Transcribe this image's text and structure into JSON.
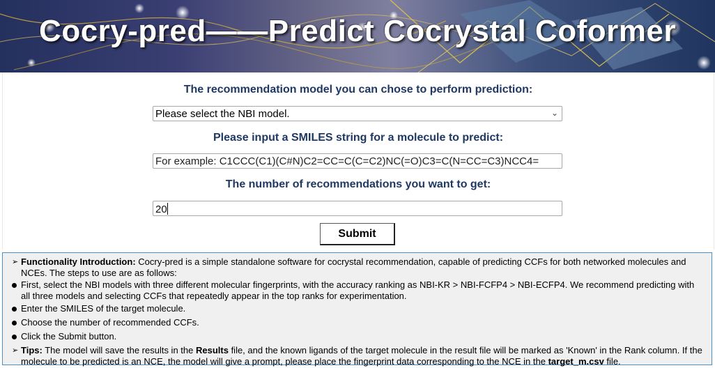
{
  "banner": {
    "title": "Cocry-pred——Predict Cocrystal Coformer"
  },
  "form": {
    "model_label": "The recommendation model you can chose to perform prediction:",
    "model_select_value": "Please select the NBI model.",
    "smiles_label": "Please input a SMILES string for a molecule to predict:",
    "smiles_placeholder": "For example: C1CCC(C1)(C#N)C2=CC=C(C=C2)NC(=O)C3=C(N=CC=C3)NCC4=",
    "count_label": "The number of recommendations you want to get:",
    "count_value": "20",
    "submit_label": "Submit"
  },
  "info": {
    "intro_title": "Functionality Introduction:",
    "intro_text": " Cocry-pred is a simple standalone software for cocrystal recommendation, capable of predicting CCFs for both networked molecules and NCEs. The steps to use are as follows:",
    "steps": [
      "First, select the NBI models with three different molecular fingerprints, with the accuracy ranking as NBI-KR > NBI-FCFP4 > NBI-ECFP4. We recommend predicting with all three models and selecting CCFs that repeatedly appear in the top ranks for experimentation.",
      "Enter the SMILES of the target molecule.",
      "Choose the number of recommended CCFs.",
      "Click the Submit button."
    ],
    "tips_title": "Tips:",
    "tips_1": " The model will save the results in the ",
    "tips_bold_1": "Results",
    "tips_2": " file, and the known ligands of the target molecule in the result file will be marked as 'Known' in the Rank column. If the molecule to be predicted is an NCE, the model will give a prompt, please place the fingerprint data corresponding to the NCE in the ",
    "tips_bold_2": "target_m.csv",
    "tips_3": " file."
  },
  "icons": {
    "select_chevron": "chevron-down-icon",
    "list_marker": "arrow-marker-icon",
    "bullet": "bullet-icon"
  }
}
